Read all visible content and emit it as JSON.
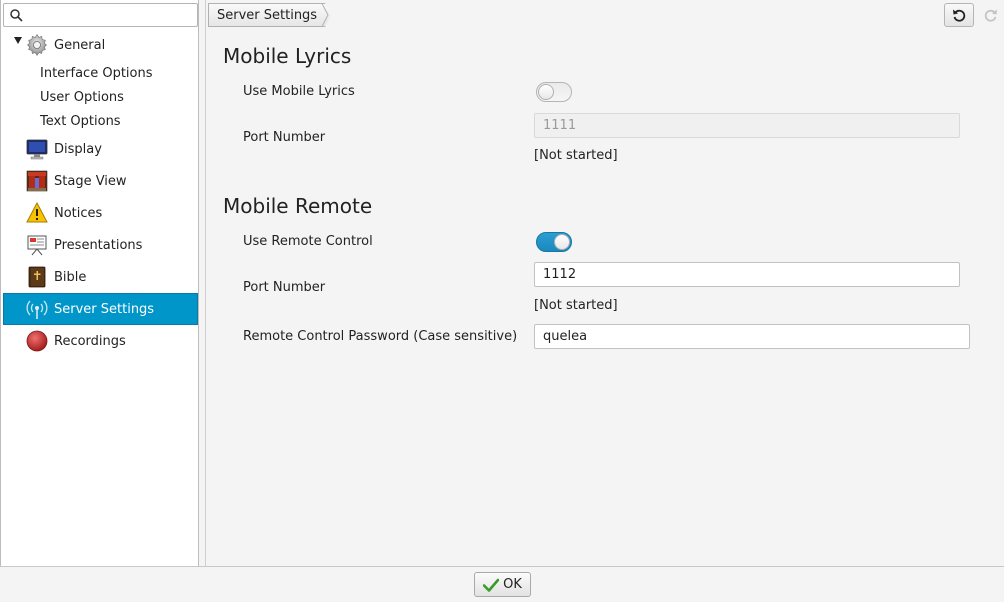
{
  "search": {
    "value": "",
    "placeholder": ""
  },
  "sidebar": {
    "items": [
      {
        "label": "General",
        "icon": "gear-icon",
        "expanded": true
      },
      {
        "label": "Interface Options"
      },
      {
        "label": "User Options"
      },
      {
        "label": "Text Options"
      },
      {
        "label": "Display",
        "icon": "monitor-icon"
      },
      {
        "label": "Stage View",
        "icon": "stage-icon"
      },
      {
        "label": "Notices",
        "icon": "warning-icon"
      },
      {
        "label": "Presentations",
        "icon": "presentation-icon"
      },
      {
        "label": "Bible",
        "icon": "bible-icon"
      },
      {
        "label": "Server Settings",
        "icon": "signal-icon",
        "selected": true
      },
      {
        "label": "Recordings",
        "icon": "record-icon"
      }
    ],
    "selected_color": "#0096c9"
  },
  "header": {
    "breadcrumb": "Server Settings",
    "undo_icon": "undo-icon",
    "redo_icon": "redo-icon"
  },
  "mobile_lyrics": {
    "title": "Mobile Lyrics",
    "use_label": "Use Mobile Lyrics",
    "enabled": false,
    "port_label": "Port Number",
    "port_value": "1111",
    "status": "[Not started]"
  },
  "mobile_remote": {
    "title": "Mobile Remote",
    "use_label": "Use Remote Control",
    "enabled": true,
    "port_label": "Port Number",
    "port_value": "1112",
    "status": "[Not started]",
    "password_label": "Remote Control Password (Case sensitive)",
    "password_value": "quelea"
  },
  "footer": {
    "ok_label": "OK",
    "accent_color": "#3a9a2a"
  }
}
